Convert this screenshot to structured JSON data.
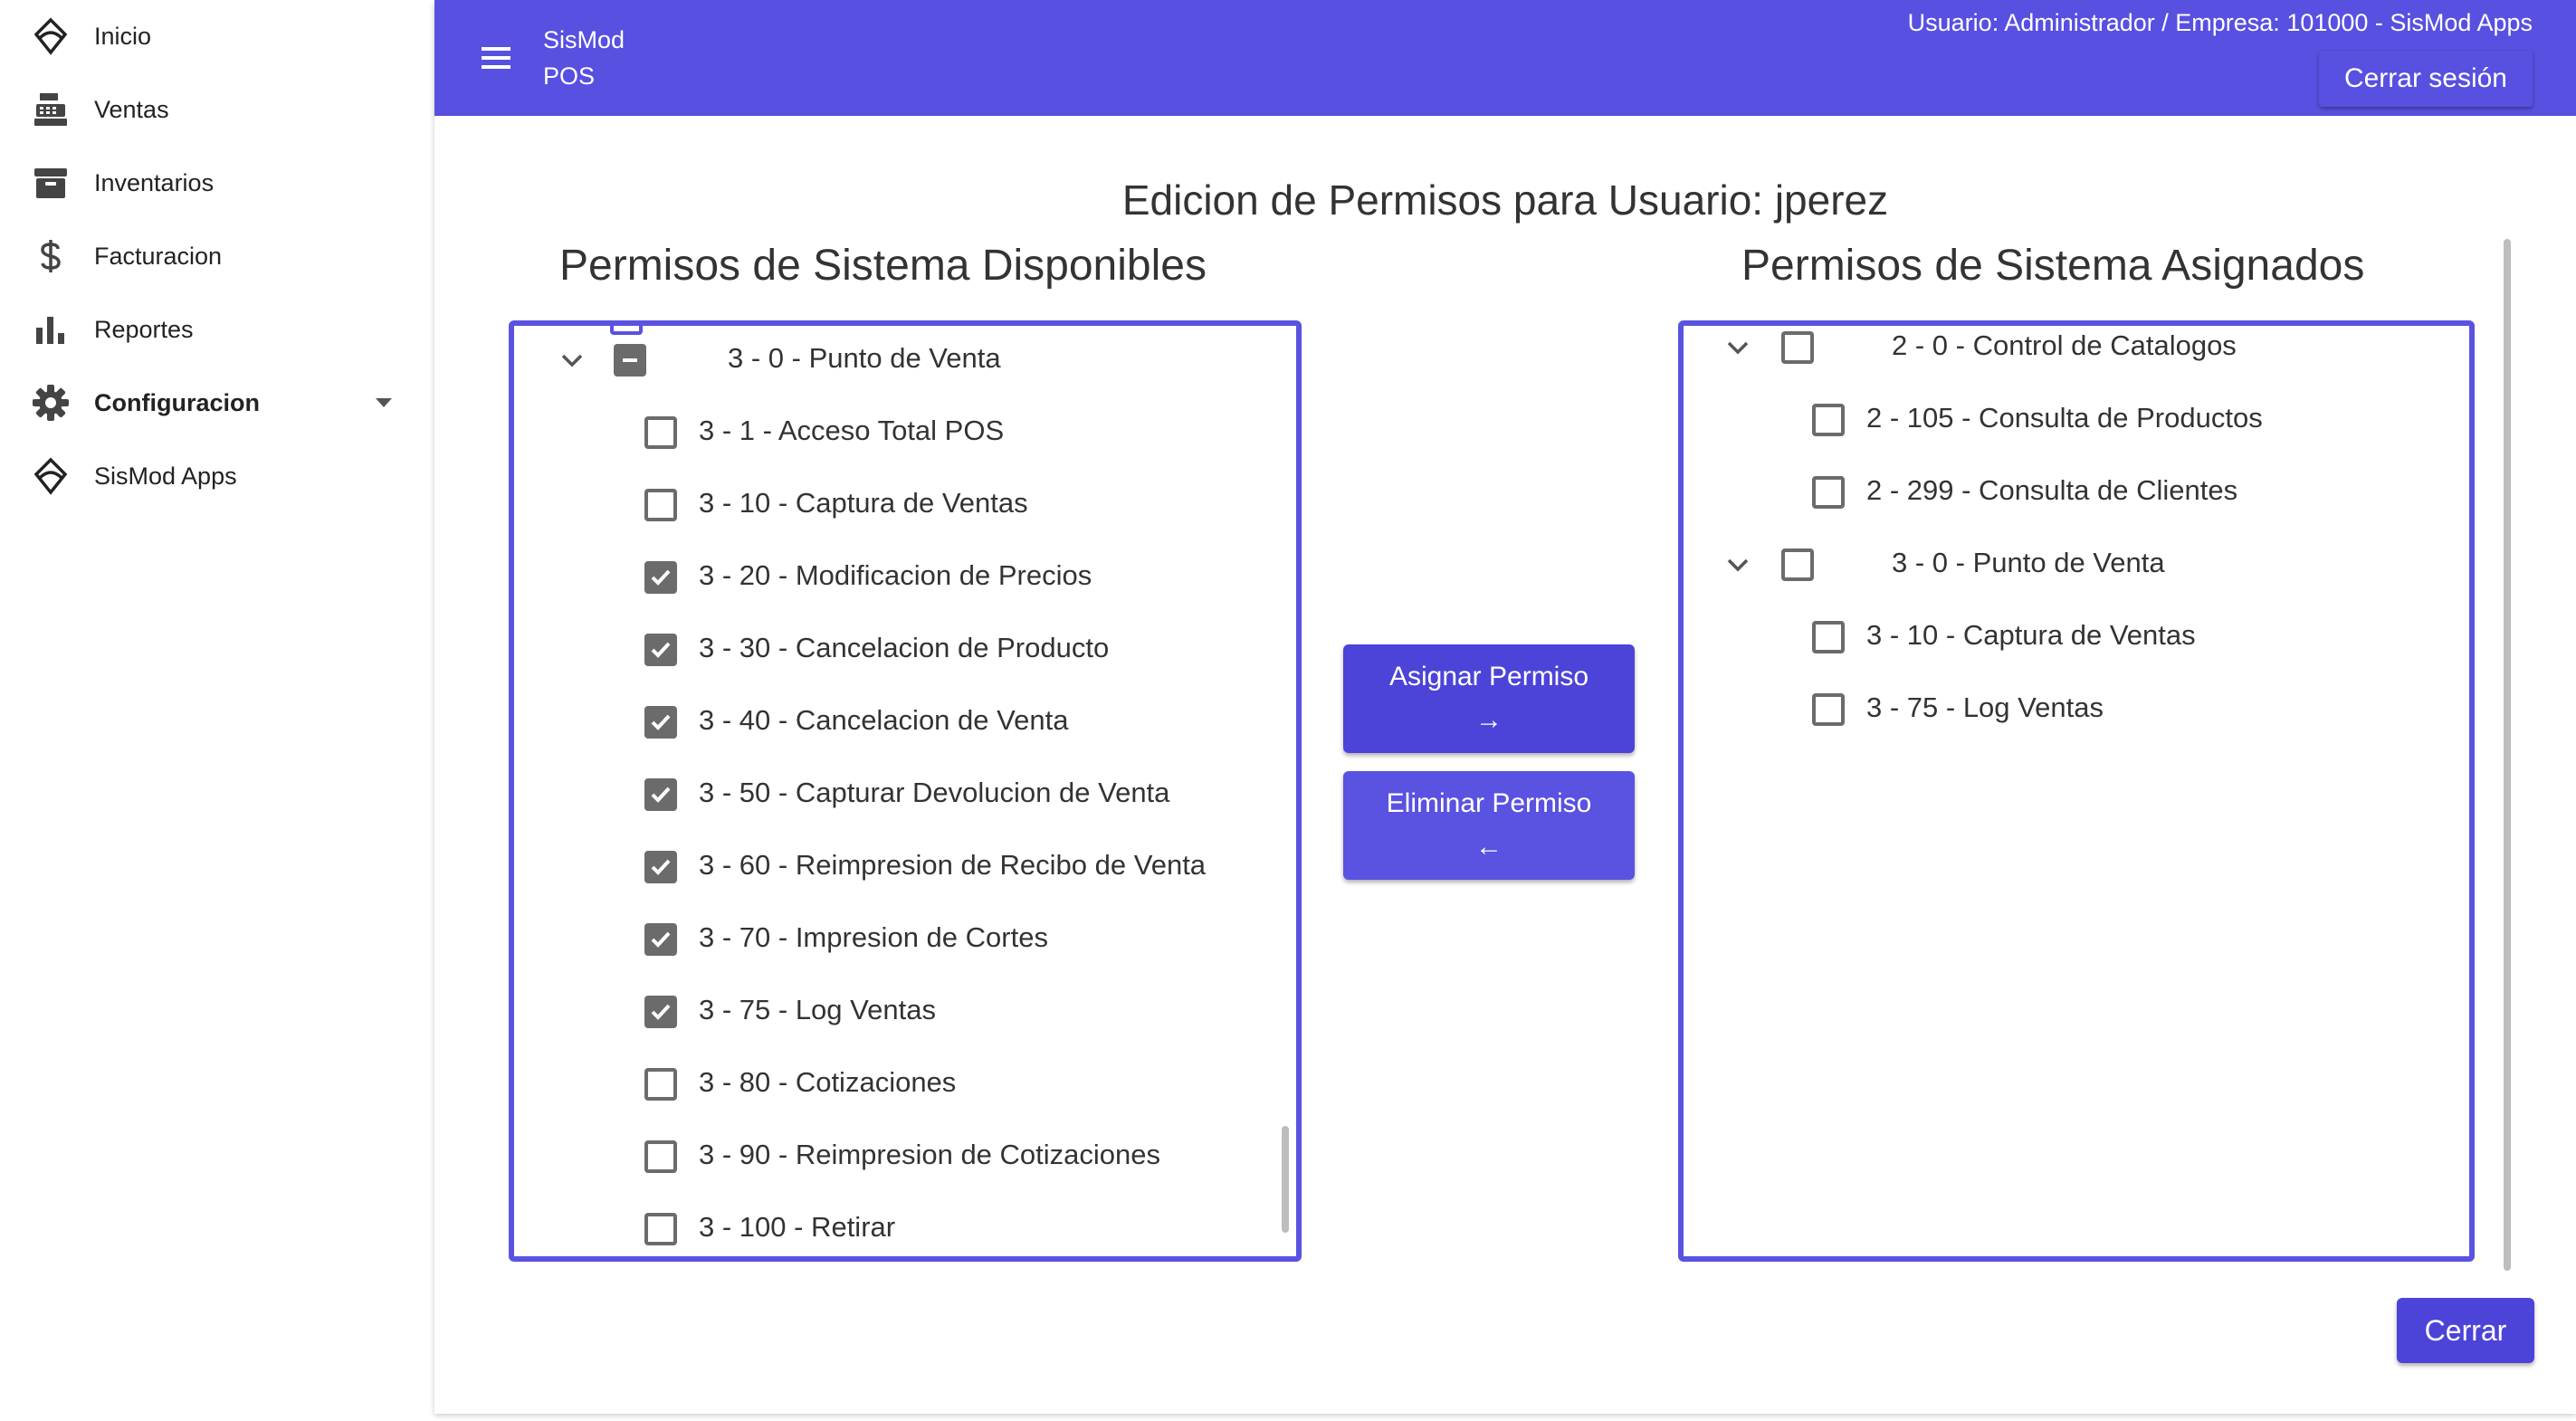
{
  "sidebar": {
    "items": [
      {
        "label": "Inicio",
        "icon": "sismod-logo-icon"
      },
      {
        "label": "Ventas",
        "icon": "cash-register-icon"
      },
      {
        "label": "Inventarios",
        "icon": "archive-icon"
      },
      {
        "label": "Facturacion",
        "icon": "dollar-icon"
      },
      {
        "label": "Reportes",
        "icon": "bar-chart-icon"
      },
      {
        "label": "Configuracion",
        "icon": "gear-icon"
      },
      {
        "label": "SisMod Apps",
        "icon": "sismod-logo-icon"
      }
    ]
  },
  "topbar": {
    "brand_line1": "SisMod",
    "brand_line2": "POS",
    "user_info": "Usuario: Administrador / Empresa: 101000 - SisMod Apps",
    "logout_label": "Cerrar sesión"
  },
  "page": {
    "title": "Edicion de Permisos para Usuario: jperez",
    "available_title": "Permisos de Sistema Disponibles",
    "assigned_title": "Permisos de Sistema Asignados",
    "assign_label": "Asignar Permiso",
    "assign_arrow": "→",
    "remove_label": "Eliminar Permiso",
    "remove_arrow": "←",
    "close_label": "Cerrar"
  },
  "available": [
    {
      "label": "3 - 0 - Punto de Venta",
      "level": 0,
      "state": "indeterminate",
      "expanded": true
    },
    {
      "label": "3 - 1 - Acceso Total POS",
      "level": 1,
      "state": "unchecked"
    },
    {
      "label": "3 - 10 - Captura de Ventas",
      "level": 1,
      "state": "unchecked"
    },
    {
      "label": "3 - 20 - Modificacion de Precios",
      "level": 1,
      "state": "checked"
    },
    {
      "label": "3 - 30 - Cancelacion de Producto",
      "level": 1,
      "state": "checked"
    },
    {
      "label": "3 - 40 - Cancelacion de Venta",
      "level": 1,
      "state": "checked"
    },
    {
      "label": "3 - 50 - Capturar Devolucion de Venta",
      "level": 1,
      "state": "checked"
    },
    {
      "label": "3 - 60 - Reimpresion de Recibo de Venta",
      "level": 1,
      "state": "checked"
    },
    {
      "label": "3 - 70 - Impresion de Cortes",
      "level": 1,
      "state": "checked"
    },
    {
      "label": "3 - 75 - Log Ventas",
      "level": 1,
      "state": "checked"
    },
    {
      "label": "3 - 80 - Cotizaciones",
      "level": 1,
      "state": "unchecked"
    },
    {
      "label": "3 - 90 - Reimpresion de Cotizaciones",
      "level": 1,
      "state": "unchecked"
    },
    {
      "label": "3 - 100 - Retirar",
      "level": 1,
      "state": "unchecked"
    }
  ],
  "assigned": [
    {
      "label": "2 - 0 - Control de Catalogos",
      "level": 0,
      "state": "unchecked",
      "expanded": true
    },
    {
      "label": "2 - 105 - Consulta de Productos",
      "level": 1,
      "state": "unchecked"
    },
    {
      "label": "2 - 299 - Consulta de Clientes",
      "level": 1,
      "state": "unchecked"
    },
    {
      "label": "3 - 0 - Punto de Venta",
      "level": 0,
      "state": "unchecked",
      "expanded": true
    },
    {
      "label": "3 - 10 - Captura de Ventas",
      "level": 1,
      "state": "unchecked"
    },
    {
      "label": "3 - 75 - Log Ventas",
      "level": 1,
      "state": "unchecked"
    }
  ],
  "colors": {
    "primary": "#5850e0",
    "primary_dark": "#4c44d8",
    "checkbox": "#6b6b6b"
  }
}
